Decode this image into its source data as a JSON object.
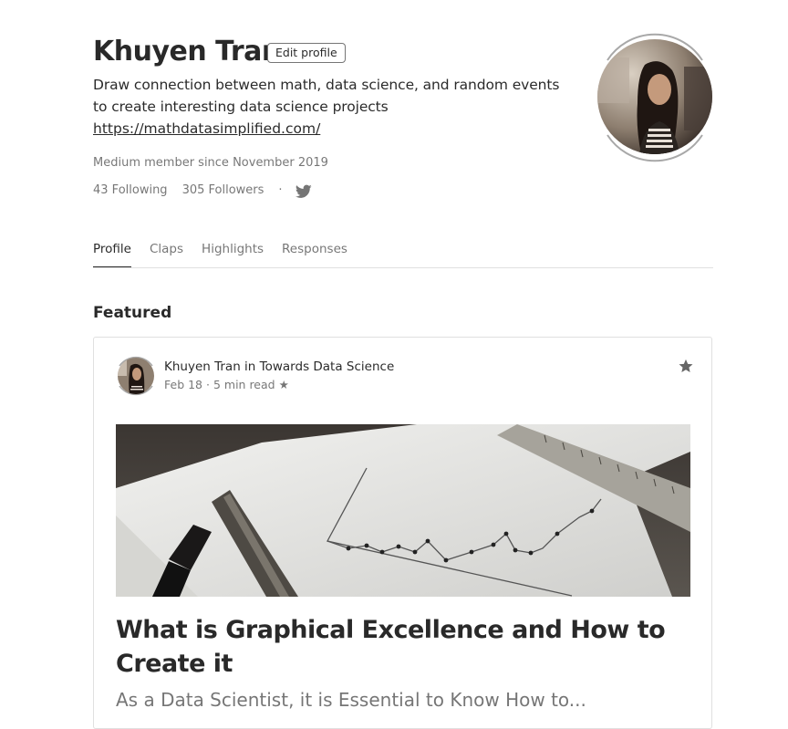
{
  "profile": {
    "name": "Khuyen Tran",
    "edit_label": "Edit profile",
    "bio": "Draw connection between math, data science, and random events to create interesting data science projects",
    "link": "https://mathdatasimplified.com/",
    "member_since": "Medium member since November 2019",
    "following": "43 Following",
    "followers": "305 Followers",
    "separator": "·",
    "social_icon": "twitter-icon",
    "avatar_icon": "profile-photo"
  },
  "tabs": [
    {
      "label": "Profile",
      "active": true
    },
    {
      "label": "Claps",
      "active": false
    },
    {
      "label": "Highlights",
      "active": false
    },
    {
      "label": "Responses",
      "active": false
    }
  ],
  "featured": {
    "heading": "Featured",
    "post": {
      "author": "Khuyen Tran",
      "in_word": "in",
      "publication": "Towards Data Science",
      "date": "Feb 18",
      "read_time": "5 min read",
      "member_star": "★",
      "bookmark_icon": "star-icon",
      "title": "What is Graphical Excellence and How to Create it",
      "subtitle": "As a Data Scientist, it is Essential to Know How to..."
    }
  },
  "colors": {
    "text_primary": "#292929",
    "text_secondary": "#757575",
    "border": "#e0e0e0"
  }
}
